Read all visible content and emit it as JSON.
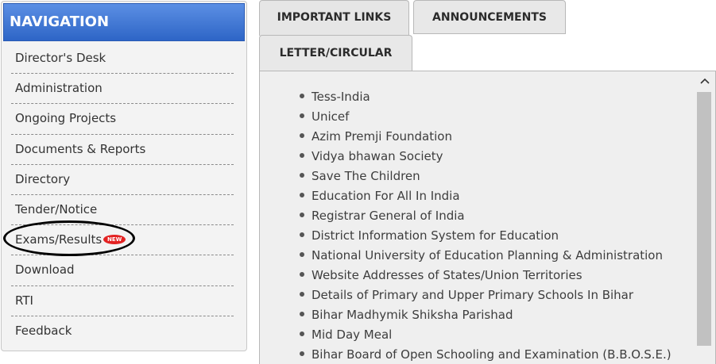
{
  "navigation": {
    "title": "NAVIGATION",
    "items": [
      {
        "label": "Director's Desk"
      },
      {
        "label": "Administration"
      },
      {
        "label": "Ongoing Projects"
      },
      {
        "label": "Documents & Reports"
      },
      {
        "label": "Directory"
      },
      {
        "label": "Tender/Notice"
      },
      {
        "label": "Exams/Results",
        "badge": "NEW"
      },
      {
        "label": "Download"
      },
      {
        "label": "RTI"
      },
      {
        "label": "Feedback"
      }
    ]
  },
  "tabs": [
    {
      "label": "IMPORTANT LINKS",
      "active": true
    },
    {
      "label": "ANNOUNCEMENTS",
      "active": false
    },
    {
      "label": "LETTER/CIRCULAR",
      "active": false
    }
  ],
  "links": [
    "Tess-India",
    "Unicef",
    "Azim Premji Foundation",
    "Vidya bhawan Society",
    "Save The Children",
    "Education For All In India",
    "Registrar General of India",
    "District Information System for Education",
    "National University of Education Planning & Administration",
    "Website Addresses of States/Union Territories",
    "Details of Primary and Upper Primary Schools In Bihar",
    "Bihar Madhymik Shiksha Parishad",
    "Mid Day Meal",
    "Bihar Board of Open Schooling and Examination (B.B.O.S.E.)"
  ],
  "icons": {
    "scroll_up": "chevron-up-icon",
    "bullet": "bullet-icon",
    "new_badge": "new-badge-icon"
  },
  "colors": {
    "nav_header_bg": "#2e65c6",
    "badge": "#e32222",
    "annotation_ellipse": "#000000"
  }
}
